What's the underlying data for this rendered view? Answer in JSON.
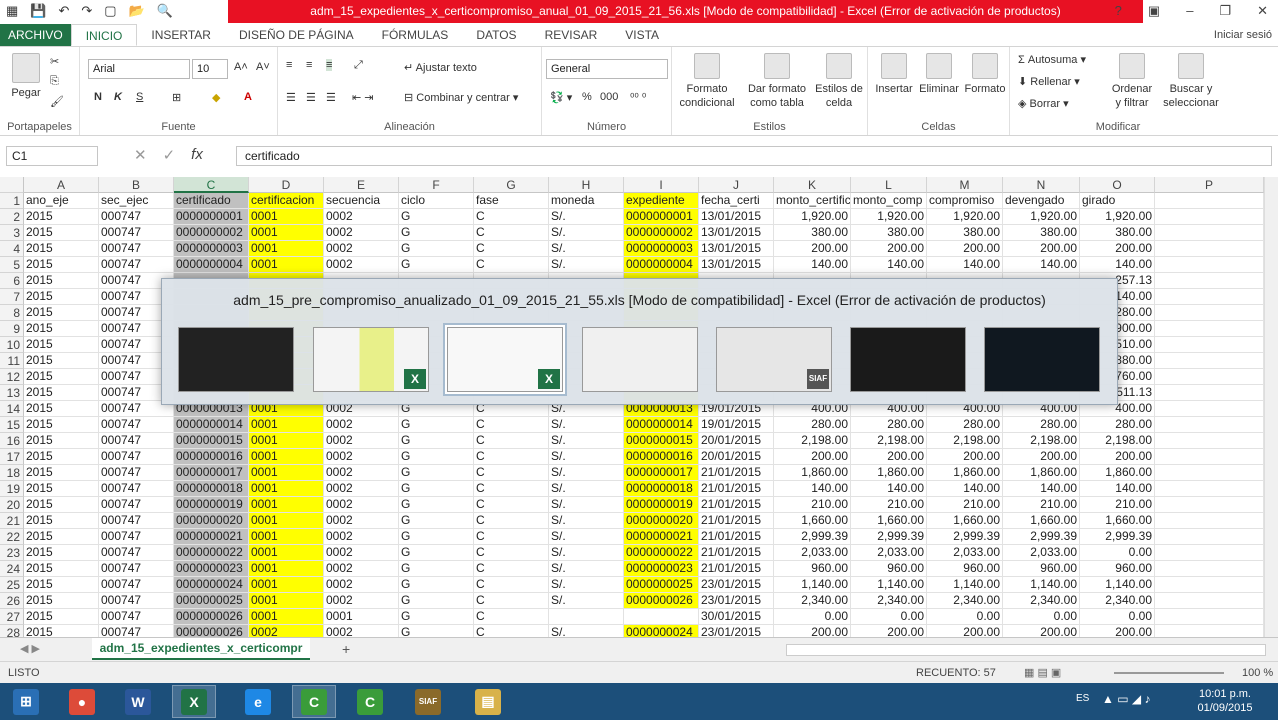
{
  "window": {
    "title": "adm_15_expedientes_x_certicompromiso_anual_01_09_2015_21_56.xls  [Modo de compatibilidad] - Excel (Error de activación de productos)",
    "help": "?",
    "controls": [
      "▣",
      "–",
      "❐",
      "✕"
    ]
  },
  "qat": [
    "▦",
    "💾",
    "↶",
    "↷",
    "▢",
    "📂",
    "🔍"
  ],
  "tabs": [
    "ARCHIVO",
    "INICIO",
    "INSERTAR",
    "DISEÑO DE PÁGINA",
    "FÓRMULAS",
    "DATOS",
    "REVISAR",
    "VISTA"
  ],
  "signin": "Iniciar sesió",
  "ribbon": {
    "groups": [
      "Portapapeles",
      "Fuente",
      "Alineación",
      "Número",
      "Estilos",
      "Celdas",
      "Modificar"
    ],
    "paste": "Pegar",
    "font": "Arial",
    "size": "10",
    "bold": "N",
    "italic": "K",
    "underline": "S",
    "wrap": "Ajustar texto",
    "merge": "Combinar y centrar",
    "numfmt": "General",
    "condfmt": [
      "Formato",
      "condicional"
    ],
    "tablefmt": [
      "Dar formato",
      "como tabla"
    ],
    "cellstyles": [
      "Estilos de",
      "celda"
    ],
    "insert": "Insertar",
    "delete": "Eliminar",
    "format": "Formato",
    "autosum": "Autosuma",
    "fill": "Rellenar",
    "clear": "Borrar",
    "sort": [
      "Ordenar",
      "y filtrar"
    ],
    "find": [
      "Buscar y",
      "seleccionar"
    ]
  },
  "formula": {
    "namebox": "C1",
    "fx": "fx",
    "value": "certificado"
  },
  "columns": [
    "A",
    "B",
    "C",
    "D",
    "E",
    "F",
    "G",
    "H",
    "I",
    "J",
    "K",
    "L",
    "M",
    "N",
    "O",
    "P"
  ],
  "headers": [
    "ano_eje",
    "sec_ejec",
    "certificado",
    "certificacion",
    "secuencia",
    "ciclo",
    "fase",
    "moneda",
    "expediente",
    "fecha_certi",
    "monto_certific",
    "monto_comp",
    "compromiso",
    "devengado",
    "girado",
    ""
  ],
  "rows": [
    [
      "2015",
      "000747",
      "0000000001",
      "0001",
      "0002",
      "G",
      "C",
      "S/.",
      "0000000001",
      "13/01/2015",
      "1,920.00",
      "1,920.00",
      "1,920.00",
      "1,920.00",
      "1,920.00"
    ],
    [
      "2015",
      "000747",
      "0000000002",
      "0001",
      "0002",
      "G",
      "C",
      "S/.",
      "0000000002",
      "13/01/2015",
      "380.00",
      "380.00",
      "380.00",
      "380.00",
      "380.00"
    ],
    [
      "2015",
      "000747",
      "0000000003",
      "0001",
      "0002",
      "G",
      "C",
      "S/.",
      "0000000003",
      "13/01/2015",
      "200.00",
      "200.00",
      "200.00",
      "200.00",
      "200.00"
    ],
    [
      "2015",
      "000747",
      "0000000004",
      "0001",
      "0002",
      "G",
      "C",
      "S/.",
      "0000000004",
      "13/01/2015",
      "140.00",
      "140.00",
      "140.00",
      "140.00",
      "140.00"
    ],
    [
      "2015",
      "000747",
      "",
      "",
      "",
      "",
      "",
      "",
      "",
      "",
      "",
      "",
      "",
      "",
      "257.13"
    ],
    [
      "2015",
      "000747",
      "",
      "",
      "",
      "",
      "",
      "",
      "",
      "",
      "",
      "",
      "",
      "",
      "140.00"
    ],
    [
      "2015",
      "000747",
      "",
      "",
      "",
      "",
      "",
      "",
      "",
      "",
      "",
      "",
      "",
      "",
      "280.00"
    ],
    [
      "2015",
      "000747",
      "",
      "",
      "",
      "",
      "",
      "",
      "",
      "",
      "",
      "",
      "",
      "",
      "900.00"
    ],
    [
      "2015",
      "000747",
      "",
      "",
      "",
      "",
      "",
      "",
      "",
      "",
      "",
      "",
      "",
      "",
      "510.00"
    ],
    [
      "2015",
      "000747",
      "",
      "",
      "",
      "",
      "",
      "",
      "",
      "",
      "",
      "",
      "",
      "",
      "880.00"
    ],
    [
      "2015",
      "000747",
      "",
      "",
      "",
      "",
      "",
      "",
      "",
      "",
      "",
      "",
      "",
      "",
      "760.00"
    ],
    [
      "2015",
      "000747",
      "",
      "",
      "",
      "",
      "",
      "",
      "",
      "",
      "",
      "",
      "",
      "",
      "511.13"
    ],
    [
      "2015",
      "000747",
      "0000000013",
      "0001",
      "0002",
      "G",
      "C",
      "S/.",
      "0000000013",
      "19/01/2015",
      "400.00",
      "400.00",
      "400.00",
      "400.00",
      "400.00"
    ],
    [
      "2015",
      "000747",
      "0000000014",
      "0001",
      "0002",
      "G",
      "C",
      "S/.",
      "0000000014",
      "19/01/2015",
      "280.00",
      "280.00",
      "280.00",
      "280.00",
      "280.00"
    ],
    [
      "2015",
      "000747",
      "0000000015",
      "0001",
      "0002",
      "G",
      "C",
      "S/.",
      "0000000015",
      "20/01/2015",
      "2,198.00",
      "2,198.00",
      "2,198.00",
      "2,198.00",
      "2,198.00"
    ],
    [
      "2015",
      "000747",
      "0000000016",
      "0001",
      "0002",
      "G",
      "C",
      "S/.",
      "0000000016",
      "20/01/2015",
      "200.00",
      "200.00",
      "200.00",
      "200.00",
      "200.00"
    ],
    [
      "2015",
      "000747",
      "0000000017",
      "0001",
      "0002",
      "G",
      "C",
      "S/.",
      "0000000017",
      "21/01/2015",
      "1,860.00",
      "1,860.00",
      "1,860.00",
      "1,860.00",
      "1,860.00"
    ],
    [
      "2015",
      "000747",
      "0000000018",
      "0001",
      "0002",
      "G",
      "C",
      "S/.",
      "0000000018",
      "21/01/2015",
      "140.00",
      "140.00",
      "140.00",
      "140.00",
      "140.00"
    ],
    [
      "2015",
      "000747",
      "0000000019",
      "0001",
      "0002",
      "G",
      "C",
      "S/.",
      "0000000019",
      "21/01/2015",
      "210.00",
      "210.00",
      "210.00",
      "210.00",
      "210.00"
    ],
    [
      "2015",
      "000747",
      "0000000020",
      "0001",
      "0002",
      "G",
      "C",
      "S/.",
      "0000000020",
      "21/01/2015",
      "1,660.00",
      "1,660.00",
      "1,660.00",
      "1,660.00",
      "1,660.00"
    ],
    [
      "2015",
      "000747",
      "0000000021",
      "0001",
      "0002",
      "G",
      "C",
      "S/.",
      "0000000021",
      "21/01/2015",
      "2,999.39",
      "2,999.39",
      "2,999.39",
      "2,999.39",
      "2,999.39"
    ],
    [
      "2015",
      "000747",
      "0000000022",
      "0001",
      "0002",
      "G",
      "C",
      "S/.",
      "0000000022",
      "21/01/2015",
      "2,033.00",
      "2,033.00",
      "2,033.00",
      "2,033.00",
      "0.00"
    ],
    [
      "2015",
      "000747",
      "0000000023",
      "0001",
      "0002",
      "G",
      "C",
      "S/.",
      "0000000023",
      "21/01/2015",
      "960.00",
      "960.00",
      "960.00",
      "960.00",
      "960.00"
    ],
    [
      "2015",
      "000747",
      "0000000024",
      "0001",
      "0002",
      "G",
      "C",
      "S/.",
      "0000000025",
      "23/01/2015",
      "1,140.00",
      "1,140.00",
      "1,140.00",
      "1,140.00",
      "1,140.00"
    ],
    [
      "2015",
      "000747",
      "0000000025",
      "0001",
      "0002",
      "G",
      "C",
      "S/.",
      "0000000026",
      "23/01/2015",
      "2,340.00",
      "2,340.00",
      "2,340.00",
      "2,340.00",
      "2,340.00"
    ],
    [
      "2015",
      "000747",
      "0000000026",
      "0001",
      "0001",
      "G",
      "C",
      "",
      "",
      "30/01/2015",
      "0.00",
      "0.00",
      "0.00",
      "0.00",
      "0.00"
    ],
    [
      "2015",
      "000747",
      "0000000026",
      "0002",
      "0002",
      "G",
      "C",
      "S/.",
      "0000000024",
      "23/01/2015",
      "200.00",
      "200.00",
      "200.00",
      "200.00",
      "200.00"
    ]
  ],
  "switcher": {
    "title": "adm_15_pre_compromiso_anualizado_01_09_2015_21_55.xls  [Modo de compatibilidad] - Excel (Error de activación de productos)",
    "badges": [
      "",
      "X",
      "X",
      "",
      "SIAF",
      "",
      ""
    ]
  },
  "sheet": {
    "tab": "adm_15_expedientes_x_certicompr",
    "add": "+"
  },
  "status": {
    "left": "LISTO",
    "count": "RECUENTO: 57",
    "zoom": "100 %"
  },
  "taskbar": {
    "apps": [
      "⊞",
      "●",
      "W",
      "X",
      "e",
      "C",
      "C",
      "SIAF",
      "▤"
    ],
    "lang": "ES",
    "time": "10:01 p.m.",
    "date": "01/09/2015"
  },
  "colors": {
    "excel_green": "#217346",
    "title_red": "#e81123",
    "highlight": "#ffff00",
    "taskbar": "#1c4f7a"
  }
}
